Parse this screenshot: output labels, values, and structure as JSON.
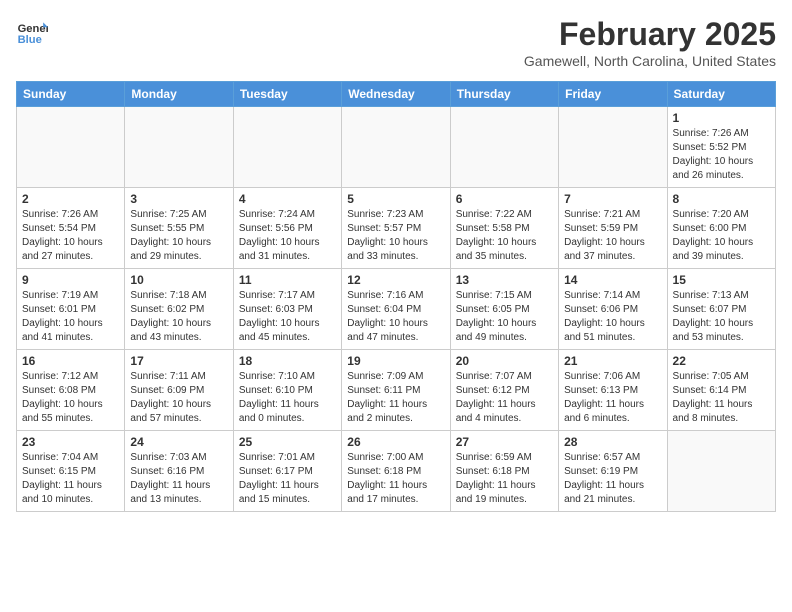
{
  "header": {
    "logo_line1": "General",
    "logo_line2": "Blue",
    "month_title": "February 2025",
    "location": "Gamewell, North Carolina, United States"
  },
  "days_of_week": [
    "Sunday",
    "Monday",
    "Tuesday",
    "Wednesday",
    "Thursday",
    "Friday",
    "Saturday"
  ],
  "weeks": [
    [
      {
        "num": "",
        "info": ""
      },
      {
        "num": "",
        "info": ""
      },
      {
        "num": "",
        "info": ""
      },
      {
        "num": "",
        "info": ""
      },
      {
        "num": "",
        "info": ""
      },
      {
        "num": "",
        "info": ""
      },
      {
        "num": "1",
        "info": "Sunrise: 7:26 AM\nSunset: 5:52 PM\nDaylight: 10 hours and 26 minutes."
      }
    ],
    [
      {
        "num": "2",
        "info": "Sunrise: 7:26 AM\nSunset: 5:54 PM\nDaylight: 10 hours and 27 minutes."
      },
      {
        "num": "3",
        "info": "Sunrise: 7:25 AM\nSunset: 5:55 PM\nDaylight: 10 hours and 29 minutes."
      },
      {
        "num": "4",
        "info": "Sunrise: 7:24 AM\nSunset: 5:56 PM\nDaylight: 10 hours and 31 minutes."
      },
      {
        "num": "5",
        "info": "Sunrise: 7:23 AM\nSunset: 5:57 PM\nDaylight: 10 hours and 33 minutes."
      },
      {
        "num": "6",
        "info": "Sunrise: 7:22 AM\nSunset: 5:58 PM\nDaylight: 10 hours and 35 minutes."
      },
      {
        "num": "7",
        "info": "Sunrise: 7:21 AM\nSunset: 5:59 PM\nDaylight: 10 hours and 37 minutes."
      },
      {
        "num": "8",
        "info": "Sunrise: 7:20 AM\nSunset: 6:00 PM\nDaylight: 10 hours and 39 minutes."
      }
    ],
    [
      {
        "num": "9",
        "info": "Sunrise: 7:19 AM\nSunset: 6:01 PM\nDaylight: 10 hours and 41 minutes."
      },
      {
        "num": "10",
        "info": "Sunrise: 7:18 AM\nSunset: 6:02 PM\nDaylight: 10 hours and 43 minutes."
      },
      {
        "num": "11",
        "info": "Sunrise: 7:17 AM\nSunset: 6:03 PM\nDaylight: 10 hours and 45 minutes."
      },
      {
        "num": "12",
        "info": "Sunrise: 7:16 AM\nSunset: 6:04 PM\nDaylight: 10 hours and 47 minutes."
      },
      {
        "num": "13",
        "info": "Sunrise: 7:15 AM\nSunset: 6:05 PM\nDaylight: 10 hours and 49 minutes."
      },
      {
        "num": "14",
        "info": "Sunrise: 7:14 AM\nSunset: 6:06 PM\nDaylight: 10 hours and 51 minutes."
      },
      {
        "num": "15",
        "info": "Sunrise: 7:13 AM\nSunset: 6:07 PM\nDaylight: 10 hours and 53 minutes."
      }
    ],
    [
      {
        "num": "16",
        "info": "Sunrise: 7:12 AM\nSunset: 6:08 PM\nDaylight: 10 hours and 55 minutes."
      },
      {
        "num": "17",
        "info": "Sunrise: 7:11 AM\nSunset: 6:09 PM\nDaylight: 10 hours and 57 minutes."
      },
      {
        "num": "18",
        "info": "Sunrise: 7:10 AM\nSunset: 6:10 PM\nDaylight: 11 hours and 0 minutes."
      },
      {
        "num": "19",
        "info": "Sunrise: 7:09 AM\nSunset: 6:11 PM\nDaylight: 11 hours and 2 minutes."
      },
      {
        "num": "20",
        "info": "Sunrise: 7:07 AM\nSunset: 6:12 PM\nDaylight: 11 hours and 4 minutes."
      },
      {
        "num": "21",
        "info": "Sunrise: 7:06 AM\nSunset: 6:13 PM\nDaylight: 11 hours and 6 minutes."
      },
      {
        "num": "22",
        "info": "Sunrise: 7:05 AM\nSunset: 6:14 PM\nDaylight: 11 hours and 8 minutes."
      }
    ],
    [
      {
        "num": "23",
        "info": "Sunrise: 7:04 AM\nSunset: 6:15 PM\nDaylight: 11 hours and 10 minutes."
      },
      {
        "num": "24",
        "info": "Sunrise: 7:03 AM\nSunset: 6:16 PM\nDaylight: 11 hours and 13 minutes."
      },
      {
        "num": "25",
        "info": "Sunrise: 7:01 AM\nSunset: 6:17 PM\nDaylight: 11 hours and 15 minutes."
      },
      {
        "num": "26",
        "info": "Sunrise: 7:00 AM\nSunset: 6:18 PM\nDaylight: 11 hours and 17 minutes."
      },
      {
        "num": "27",
        "info": "Sunrise: 6:59 AM\nSunset: 6:18 PM\nDaylight: 11 hours and 19 minutes."
      },
      {
        "num": "28",
        "info": "Sunrise: 6:57 AM\nSunset: 6:19 PM\nDaylight: 11 hours and 21 minutes."
      },
      {
        "num": "",
        "info": ""
      }
    ]
  ]
}
